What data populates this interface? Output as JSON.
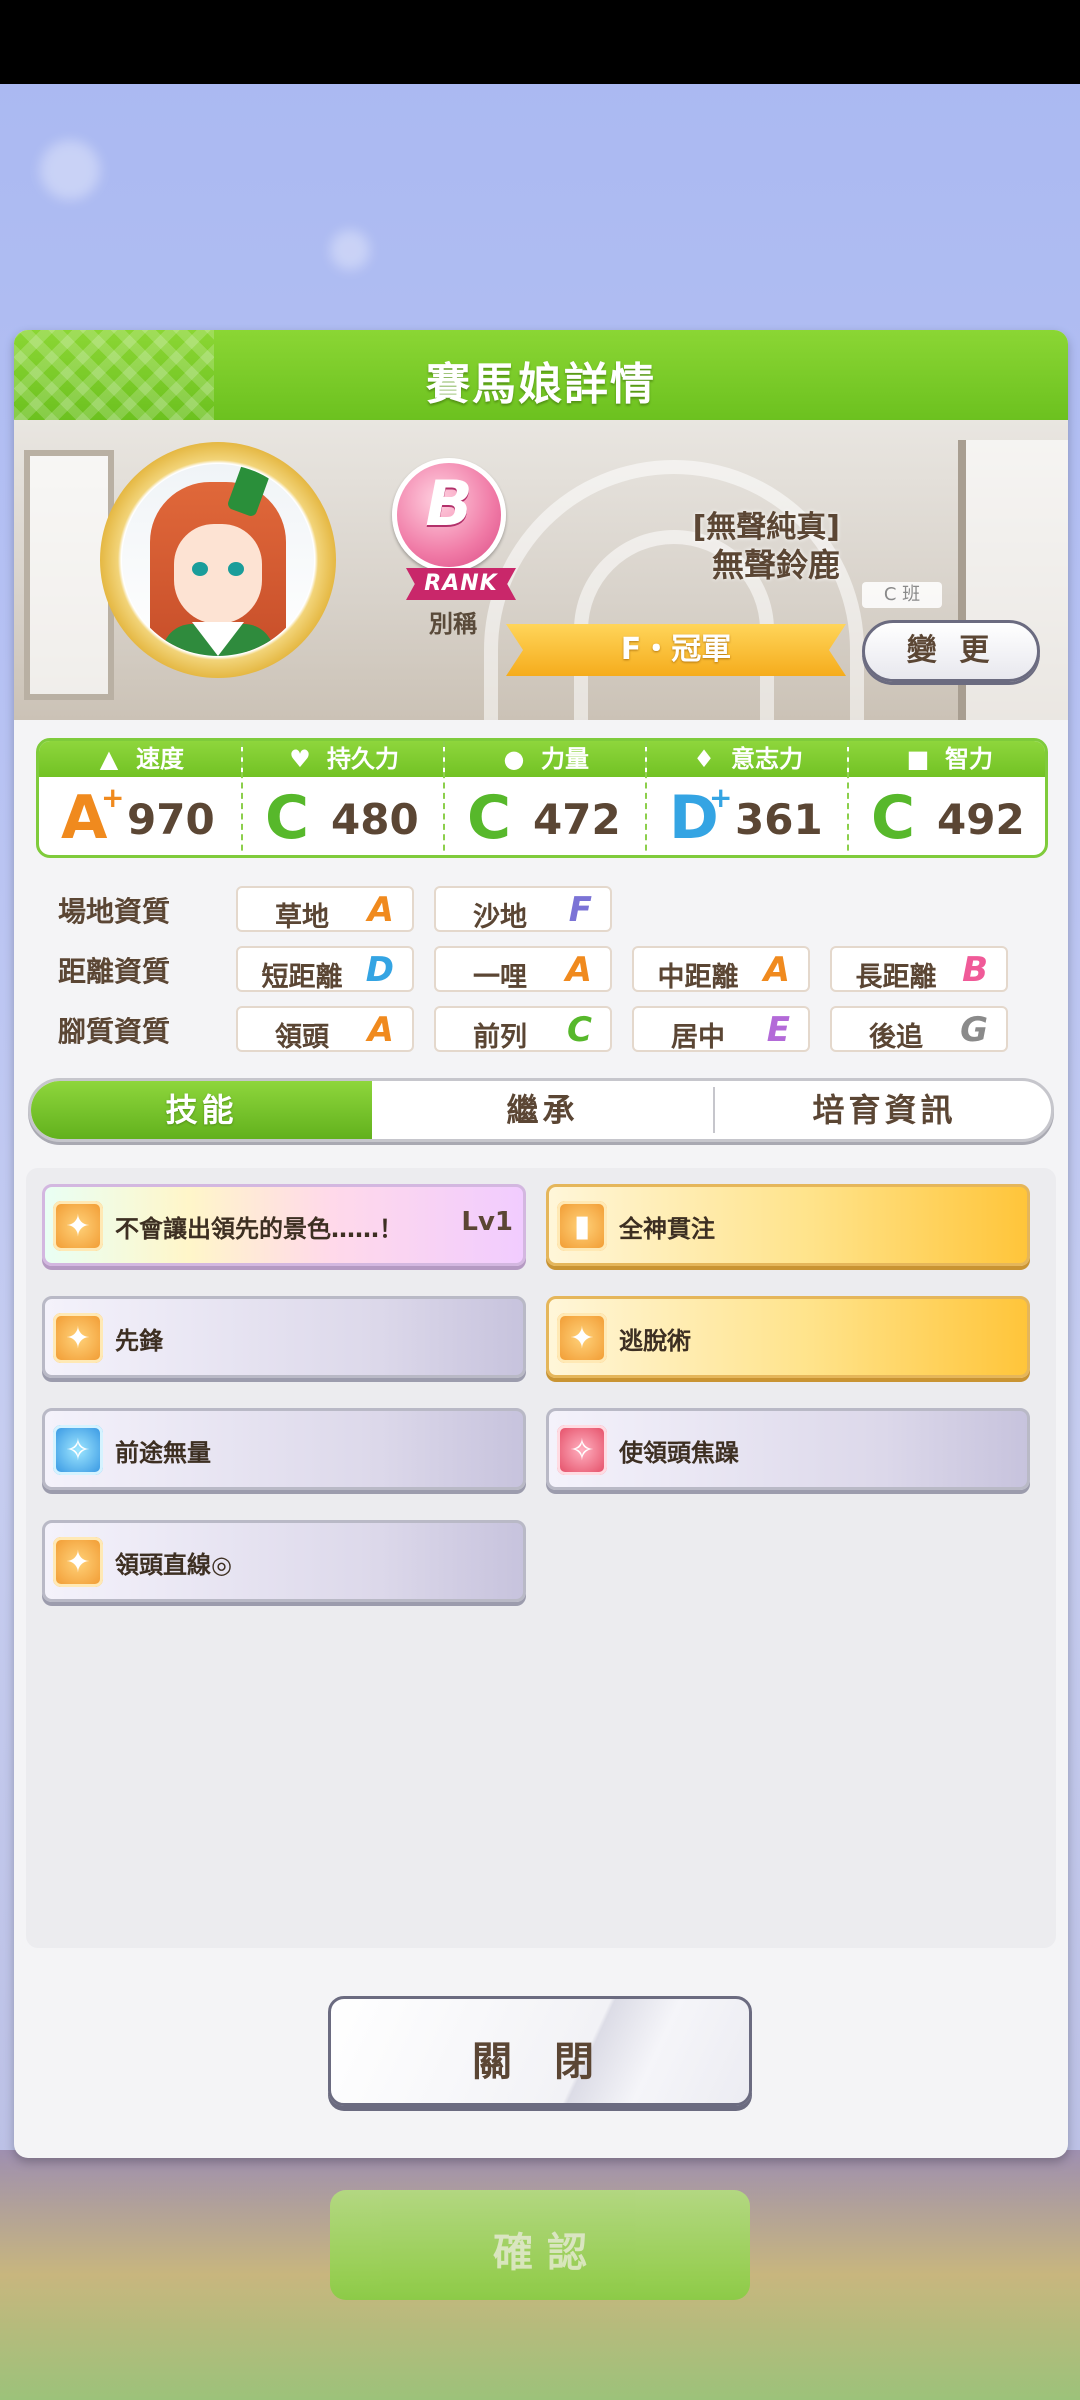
{
  "dialog": {
    "title": "賽馬娘詳情"
  },
  "profile": {
    "rank_letter": "B",
    "rank_label": "RANK",
    "nickname_label": "別稱",
    "title_sub": "[無聲純真]",
    "name": "無聲鈴鹿",
    "class_tag": "C 班",
    "title_ribbon": "F・冠軍",
    "change_button": "變 更"
  },
  "stats": [
    {
      "label": "速度",
      "icon": "shoe-icon",
      "grade": "A",
      "plus": "+",
      "value": "970",
      "color": "#f08a1e"
    },
    {
      "label": "持久力",
      "icon": "heart-icon",
      "grade": "C",
      "plus": "",
      "value": "480",
      "color": "#57b82b"
    },
    {
      "label": "力量",
      "icon": "muscle-icon",
      "grade": "C",
      "plus": "",
      "value": "472",
      "color": "#57b82b"
    },
    {
      "label": "意志力",
      "icon": "flame-icon",
      "grade": "D",
      "plus": "+",
      "value": "361",
      "color": "#34a4e3"
    },
    {
      "label": "智力",
      "icon": "graduation-cap-icon",
      "grade": "C",
      "plus": "",
      "value": "492",
      "color": "#57b82b"
    }
  ],
  "aptitude": {
    "track": {
      "label": "場地資質",
      "items": [
        {
          "name": "草地",
          "grade": "A"
        },
        {
          "name": "沙地",
          "grade": "F"
        }
      ]
    },
    "distance": {
      "label": "距離資質",
      "items": [
        {
          "name": "短距離",
          "grade": "D"
        },
        {
          "name": "一哩",
          "grade": "A"
        },
        {
          "name": "中距離",
          "grade": "A"
        },
        {
          "name": "長距離",
          "grade": "B"
        }
      ]
    },
    "style": {
      "label": "腳質資質",
      "items": [
        {
          "name": "領頭",
          "grade": "A"
        },
        {
          "name": "前列",
          "grade": "C"
        },
        {
          "name": "居中",
          "grade": "E"
        },
        {
          "name": "後追",
          "grade": "G"
        }
      ]
    }
  },
  "grade_colors": {
    "A": "#f08a1e",
    "B": "#f05a98",
    "C": "#57b82b",
    "D": "#34a4e3",
    "E": "#b36ad8",
    "F": "#7b73d6",
    "G": "#8a8a8a"
  },
  "tabs": [
    "技能",
    "繼承",
    "培育資訊"
  ],
  "skills": [
    {
      "name": "不會讓出領先的景色……！",
      "level": "Lv1",
      "style": "rainbow",
      "icon": "runner-icon"
    },
    {
      "name": "全神貫注",
      "level": "",
      "style": "gold",
      "icon": "gate-icon"
    },
    {
      "name": "先鋒",
      "level": "",
      "style": "normal",
      "icon": "runner-icon"
    },
    {
      "name": "逃脫術",
      "level": "",
      "style": "gold",
      "icon": "runner-icon"
    },
    {
      "name": "前途無量",
      "level": "",
      "style": "normal",
      "icon": "sparkle-icon"
    },
    {
      "name": "使領頭焦躁",
      "level": "",
      "style": "normal",
      "icon": "sparkle-red-icon"
    },
    {
      "name": "領頭直線◎",
      "level": "",
      "style": "normal",
      "icon": "runner-icon"
    }
  ],
  "close_button": "關 閉",
  "background_button": "確 認"
}
